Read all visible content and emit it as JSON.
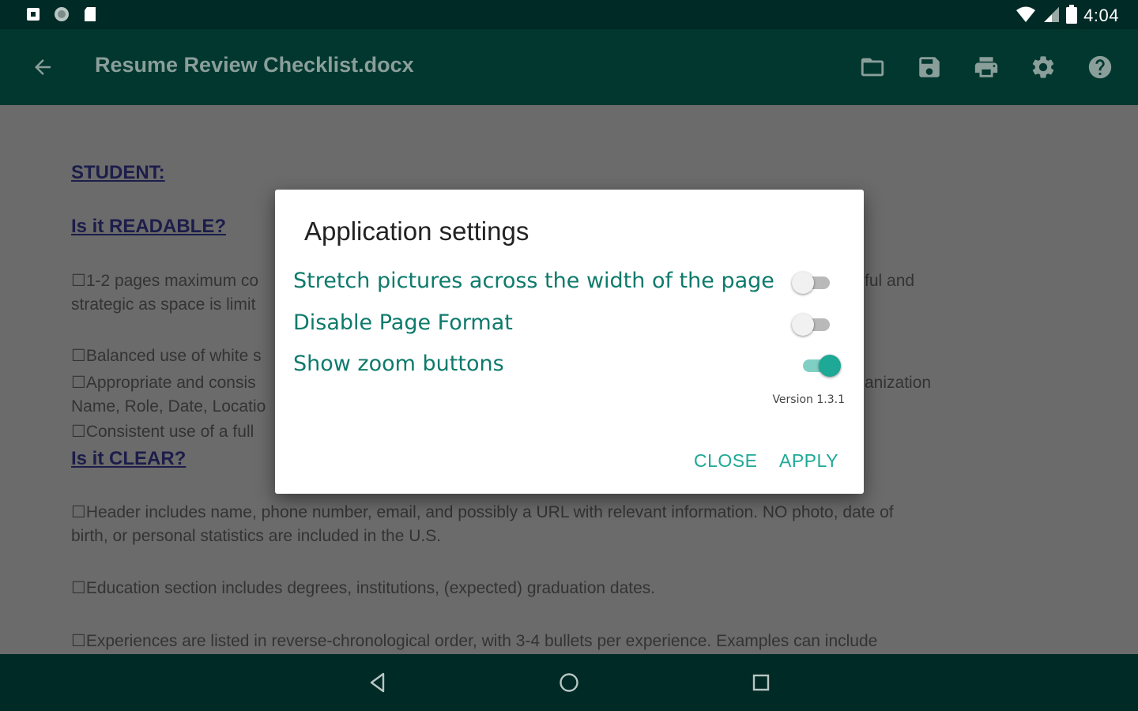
{
  "status_bar": {
    "time": "4:04",
    "left_icons": [
      "notification-square-icon",
      "circle-notification-icon",
      "sd-card-icon"
    ],
    "right_icons": [
      "wifi-icon",
      "cellular-signal-icon",
      "battery-icon"
    ]
  },
  "app_bar": {
    "title": "Resume Review Checklist.docx",
    "back_icon": "arrow-left-icon",
    "actions": [
      "folder-icon",
      "save-icon",
      "print-icon",
      "settings-icon",
      "help-icon"
    ]
  },
  "document": {
    "heading_student": "STUDENT:",
    "heading_readable": "Is it READABLE?",
    "para1_line1": "☐1-2 pages maximum co",
    "para1_line1_right": "ful and",
    "para1_line2": "strategic as space is limit",
    "para2": "☐Balanced use of white s",
    "para3_line1": "☐Appropriate and consis",
    "para3_line1_right": "anization",
    "para3_line2": "Name, Role, Date, Locatio",
    "para4": "☐Consistent use of a full",
    "heading_clear": "Is it CLEAR?",
    "para5_line1": "☐Header includes name, phone number, email, and possibly a URL with relevant information. NO photo, date of",
    "para5_line2": "birth, or personal statistics are included in the U.S.",
    "para6": "☐Education section includes degrees, institutions, (expected) graduation dates.",
    "para7": "☐Experiences are listed in reverse-chronological order, with 3-4 bullets per experience. Examples can include"
  },
  "dialog": {
    "title": "Application settings",
    "options": [
      {
        "label": "Stretch pictures across the width of the page",
        "enabled": false
      },
      {
        "label": "Disable Page Format",
        "enabled": false
      },
      {
        "label": "Show zoom buttons",
        "enabled": true
      }
    ],
    "version": "Version 1.3.1",
    "close_label": "CLOSE",
    "apply_label": "APPLY",
    "accent_color": "#1ea896",
    "option_text_color": "#0d7a6b"
  },
  "nav_bar": {
    "buttons": [
      "back-triangle-icon",
      "home-circle-icon",
      "recents-square-icon"
    ]
  },
  "colors": {
    "status_bar": "#002a25",
    "app_bar": "#01372f",
    "scrim_background": "#6b6b6b"
  }
}
